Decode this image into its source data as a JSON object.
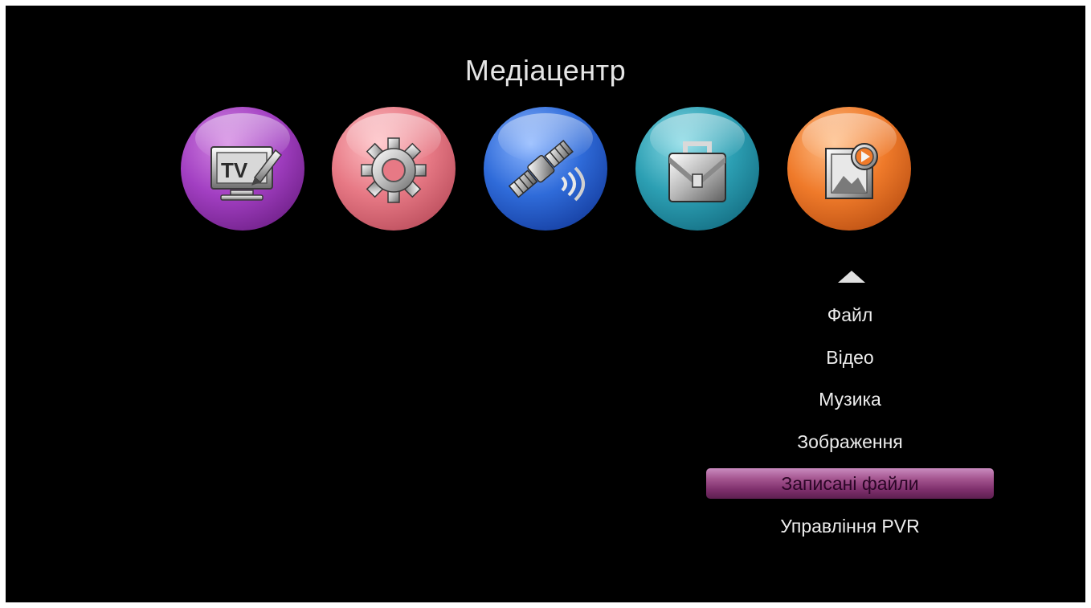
{
  "screen": {
    "title": "Медіацентр"
  },
  "top_icons": [
    {
      "name": "tv-icon",
      "label": "TV",
      "color": "#a23fc2"
    },
    {
      "name": "settings-gear-icon",
      "color": "#e77985"
    },
    {
      "name": "satellite-icon",
      "color": "#2f6bd9"
    },
    {
      "name": "toolbox-icon",
      "color": "#2c9fb3"
    },
    {
      "name": "media-icon",
      "color": "#ef7a2a",
      "selected": true
    }
  ],
  "menu": {
    "items": [
      {
        "label": "Файл"
      },
      {
        "label": "Відео"
      },
      {
        "label": "Музика"
      },
      {
        "label": "Зображення"
      },
      {
        "label": "Записані файли",
        "selected": true
      },
      {
        "label": "Управління PVR"
      }
    ],
    "highlight_color": "#a4558f"
  }
}
